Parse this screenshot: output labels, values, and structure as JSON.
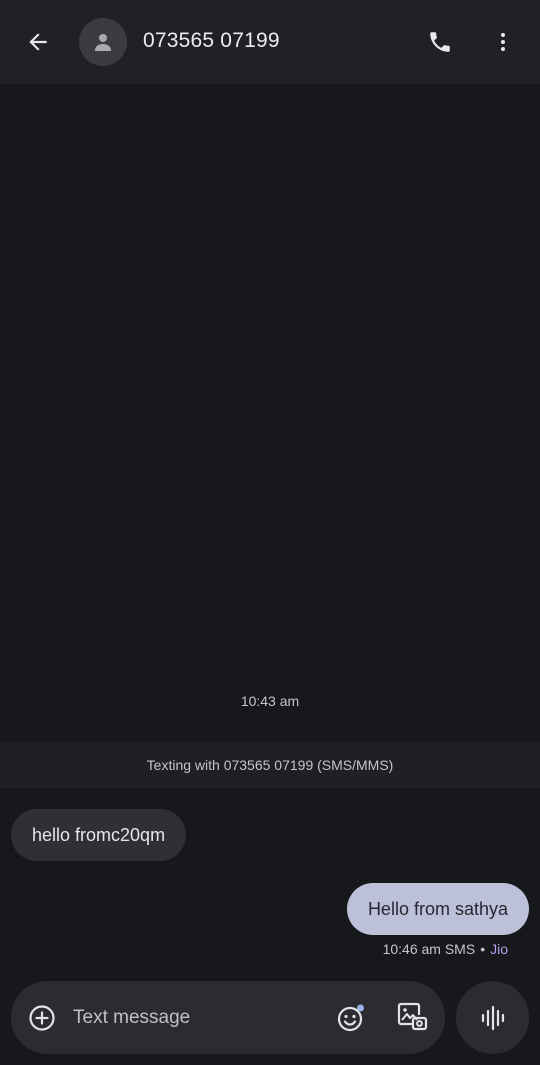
{
  "header": {
    "contact_name": "073565 07199",
    "back_icon": "arrow-back-icon",
    "avatar_icon": "person-icon",
    "call_icon": "phone-icon",
    "more_icon": "more-vert-icon"
  },
  "conversation": {
    "timestamp": "10:43 am",
    "texting_banner": "Texting with 073565 07199 (SMS/MMS)",
    "messages": [
      {
        "direction": "incoming",
        "text": "hello fromc20qm"
      },
      {
        "direction": "outgoing",
        "text": "Hello from sathya",
        "time": "10:46 am",
        "type": "SMS",
        "separator": "•",
        "carrier": "Jio"
      }
    ]
  },
  "composer": {
    "placeholder": "Text message",
    "value": "",
    "add_icon": "add-circle-icon",
    "emoji_icon": "emoji-icon",
    "gallery_icon": "gallery-icon",
    "voice_icon": "voice-waveform-icon"
  },
  "colors": {
    "background": "#17181c",
    "header": "#202125",
    "incoming_bubble": "#2f3034",
    "outgoing_bubble": "#bcc0d8",
    "carrier_accent": "#b79cf0",
    "composer": "#2b2c30"
  }
}
